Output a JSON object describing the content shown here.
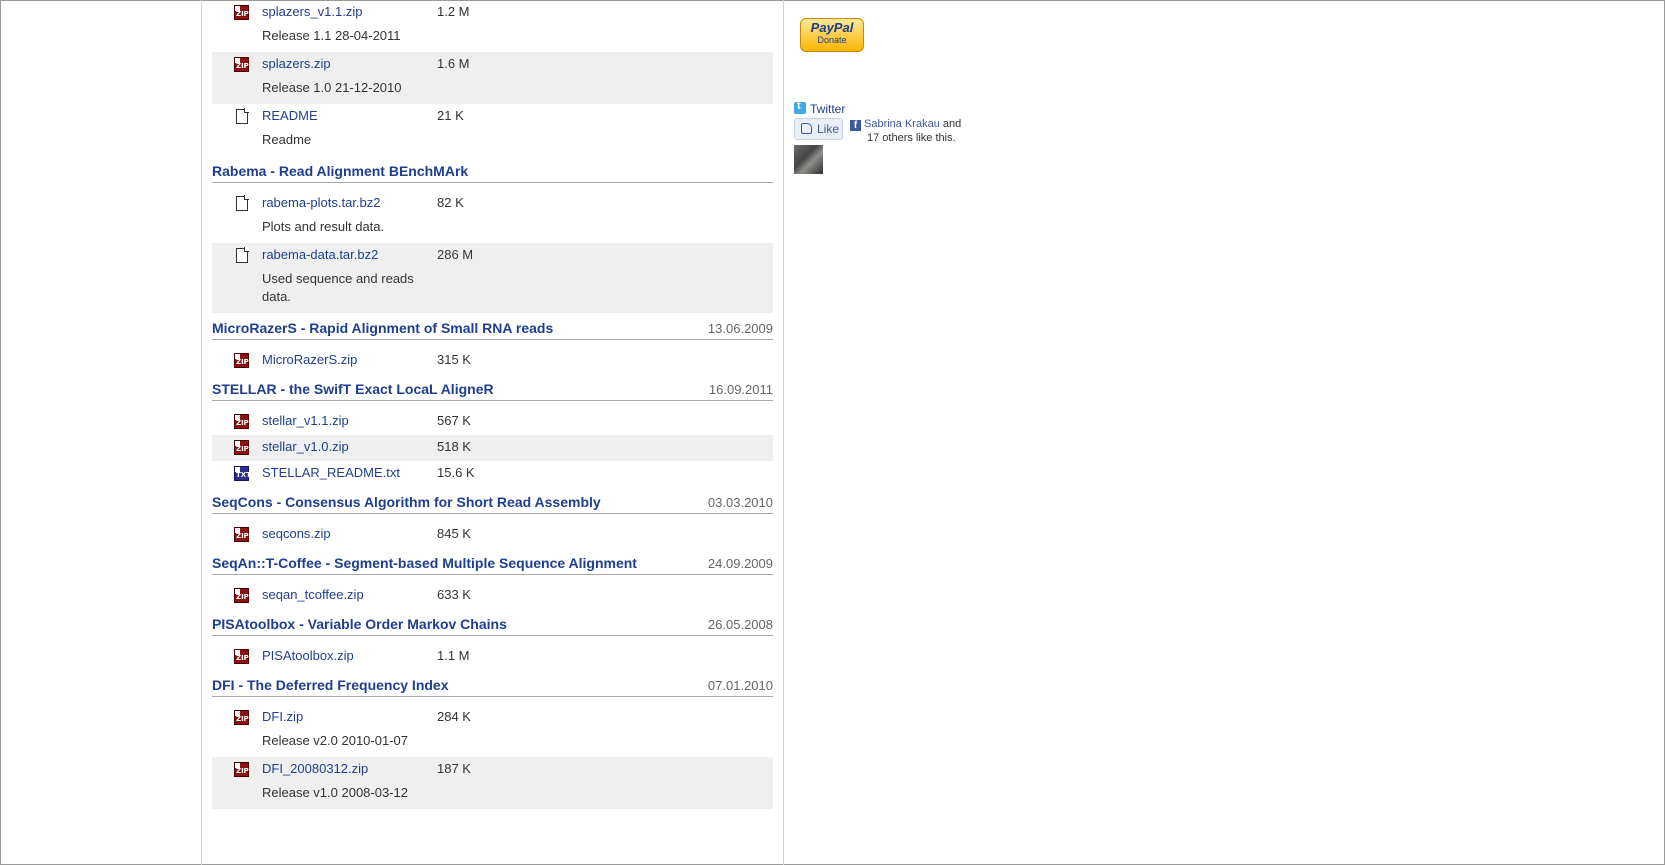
{
  "top_files": [
    {
      "icon": "zip-icon",
      "name": "splazers_v1.1.zip",
      "size": "1.2 M",
      "desc": "Release 1.1 28-04-2011",
      "shaded": false
    },
    {
      "icon": "zip-icon",
      "name": "splazers.zip",
      "size": "1.6 M",
      "desc": "Release 1.0 21-12-2010",
      "shaded": true
    },
    {
      "icon": "document-icon",
      "name": "README",
      "size": "21 K",
      "desc": "Readme",
      "shaded": false
    }
  ],
  "sections": [
    {
      "title": "Rabema - Read Alignment BEnchMArk",
      "date": "",
      "files": [
        {
          "icon": "document-icon",
          "name": "rabema-plots.tar.bz2",
          "size": "82 K",
          "desc": "Plots and result data.",
          "shaded": false
        },
        {
          "icon": "document-icon",
          "name": "rabema-data.tar.bz2",
          "size": "286 M",
          "desc": "Used sequence and reads data.",
          "shaded": true
        }
      ]
    },
    {
      "title": "MicroRazerS - Rapid Alignment of Small RNA reads",
      "date": "13.06.2009",
      "files": [
        {
          "icon": "zip-icon",
          "name": "MicroRazerS.zip",
          "size": "315 K",
          "desc": "",
          "shaded": false
        }
      ]
    },
    {
      "title": "STELLAR - the SwifT Exact LocaL AligneR",
      "date": "16.09.2011",
      "files": [
        {
          "icon": "zip-icon",
          "name": "stellar_v1.1.zip",
          "size": "567 K",
          "desc": "",
          "shaded": false
        },
        {
          "icon": "zip-icon",
          "name": "stellar_v1.0.zip",
          "size": "518 K",
          "desc": "",
          "shaded": true
        },
        {
          "icon": "txt-icon",
          "name": "STELLAR_README.txt",
          "size": "15.6 K",
          "desc": "",
          "shaded": false
        }
      ]
    },
    {
      "title": "SeqCons - Consensus Algorithm for Short Read Assembly",
      "date": "03.03.2010",
      "files": [
        {
          "icon": "zip-icon",
          "name": "seqcons.zip",
          "size": "845 K",
          "desc": "",
          "shaded": false
        }
      ]
    },
    {
      "title": "SeqAn::T-Coffee - Segment-based Multiple Sequence Alignment",
      "date": "24.09.2009",
      "files": [
        {
          "icon": "zip-icon",
          "name": "seqan_tcoffee.zip",
          "size": "633 K",
          "desc": "",
          "shaded": false
        }
      ]
    },
    {
      "title": "PISAtoolbox - Variable Order Markov Chains",
      "date": "26.05.2008",
      "files": [
        {
          "icon": "zip-icon",
          "name": "PISAtoolbox.zip",
          "size": "1.1 M",
          "desc": "",
          "shaded": false
        }
      ]
    },
    {
      "title": "DFI - The Deferred Frequency Index",
      "date": "07.01.2010",
      "files": [
        {
          "icon": "zip-icon",
          "name": "DFI.zip",
          "size": "284 K",
          "desc": "Release v2.0 2010-01-07",
          "shaded": false
        },
        {
          "icon": "zip-icon",
          "name": "DFI_20080312.zip",
          "size": "187 K",
          "desc": "Release v1.0 2008-03-12",
          "shaded": true
        }
      ]
    }
  ],
  "icons": {
    "zip_text": "ZIP",
    "txt_text": "TXT"
  },
  "sidebar": {
    "paypal_logo": "PayPal",
    "paypal_label": "Donate",
    "twitter_label": "Twitter",
    "like_label": "Like",
    "fb_name": "Sabrina Krakau",
    "fb_and": "and",
    "fb_others": "17 others like this."
  },
  "colors": {
    "link": "#1f3f8e",
    "shaded_row": "#efefef",
    "zip_icon": "#8e1111",
    "facebook": "#3b5998"
  }
}
